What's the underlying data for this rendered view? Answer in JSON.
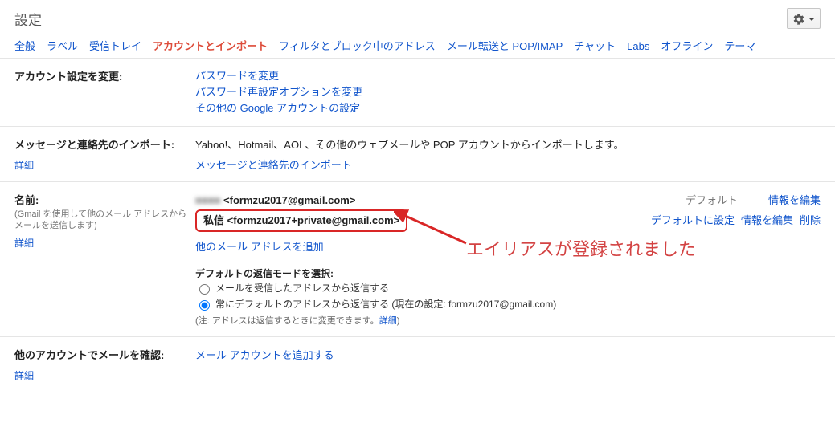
{
  "header": {
    "title": "設定"
  },
  "tabs": [
    "全般",
    "ラベル",
    "受信トレイ",
    "アカウントとインポート",
    "フィルタとブロック中のアドレス",
    "メール転送と POP/IMAP",
    "チャット",
    "Labs",
    "オフライン",
    "テーマ"
  ],
  "active_tab_index": 3,
  "sections": {
    "account": {
      "title": "アカウント設定を変更:",
      "links": [
        "パスワードを変更",
        "パスワード再設定オプションを変更",
        "その他の Google アカウントの設定"
      ]
    },
    "import": {
      "title": "メッセージと連絡先のインポート:",
      "body": "Yahoo!、Hotmail、AOL、その他のウェブメールや POP アカウントからインポートします。",
      "link": "メッセージと連絡先のインポート",
      "detail": "詳細"
    },
    "name": {
      "title": "名前:",
      "subtitle": "(Gmail を使用して他のメール アドレスからメールを送信します)",
      "detail": "詳細",
      "rows": [
        {
          "blur": "■■■■",
          "addr": " <formzu2017@gmail.com>",
          "status": "デフォルト",
          "actions": [
            "情報を編集"
          ],
          "boxed": false
        },
        {
          "blur": "",
          "addr": "私信 <formzu2017+private@gmail.com>",
          "status": "",
          "actions": [
            "デフォルトに設定",
            "情報を編集",
            "削除"
          ],
          "boxed": true
        }
      ],
      "add_link": "他のメール アドレスを追加",
      "reply_title": "デフォルトの返信モードを選択:",
      "reply_opts": [
        "メールを受信したアドレスから返信する",
        "常にデフォルトのアドレスから返信する (現在の設定: formzu2017@gmail.com)"
      ],
      "reply_checked_index": 1,
      "note_prefix": "(注: アドレスは返信するときに変更できます。",
      "note_link": "詳細",
      "note_suffix": ")"
    },
    "other": {
      "title": "他のアカウントでメールを確認:",
      "link": "メール アカウントを追加する",
      "detail": "詳細"
    }
  },
  "annotation": "エイリアスが登録されました"
}
